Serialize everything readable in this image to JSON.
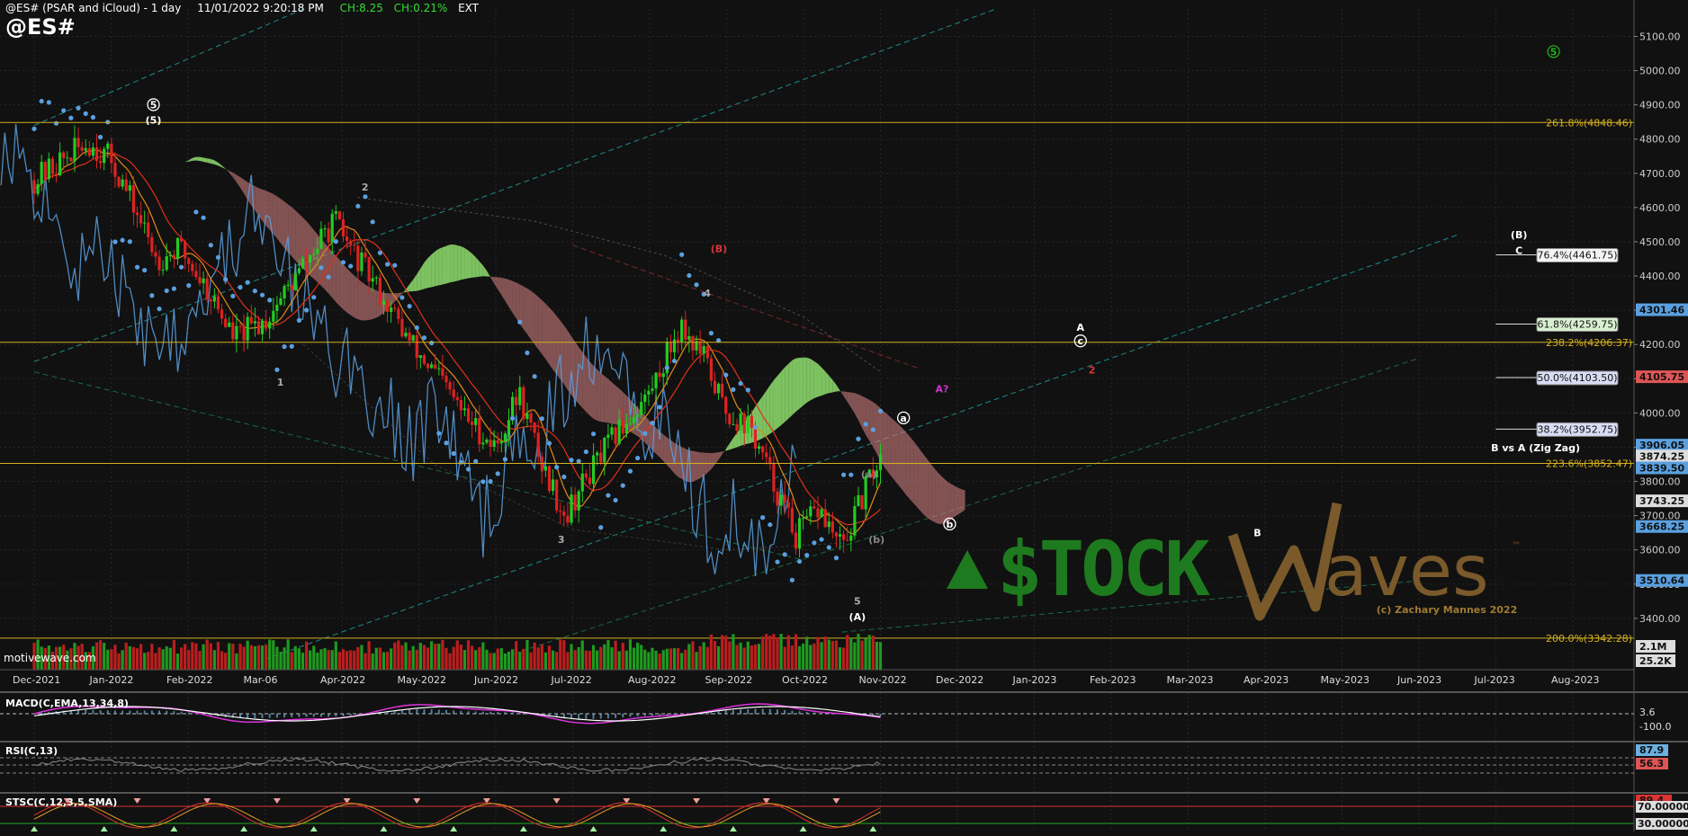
{
  "header": {
    "study": "@ES# (PSAR and iCloud) - 1 day",
    "datetime": "11/01/2022 9:20:18 PM",
    "change": "CH:8.25",
    "change_pct": "CH:0.21%",
    "session": "EXT"
  },
  "symbol": "@ES#",
  "watermark": "motivewave.com",
  "branding": {
    "logo_left": "$TOCK",
    "logo_right": "aves",
    "tm": "™",
    "copyright": "(c) Zachary Mannes 2022"
  },
  "colors": {
    "background": "#111111",
    "up_candle": "#22cc22",
    "down_candle": "#dd2222",
    "psar": "#5aa0e0",
    "fib": "#d4b020",
    "cloud_bull": "#90e070",
    "cloud_bear": "#d08080",
    "macd": "#dd33dd",
    "histogram": "#6ab0e0",
    "logo_green": "#1e7a1e",
    "logo_brown": "#7a5a2a"
  },
  "chart_data": [
    {
      "type": "line",
      "name": "price",
      "ylim": [
        3250,
        5180
      ],
      "x_labels": [
        "Dec-2021",
        "Jan-2022",
        "Feb-2022",
        "Mar-06",
        "Apr-2022",
        "May-2022",
        "Jun-2022",
        "Jul-2022",
        "Aug-2022",
        "Sep-2022",
        "Oct-2022",
        "Nov-2022",
        "Dec-2022",
        "Jan-2023",
        "Feb-2023",
        "Mar-2023",
        "Apr-2023",
        "May-2023",
        "Jun-2023",
        "Jul-2023",
        "Aug-2023"
      ],
      "y_ticks": [
        3400,
        3500,
        3600,
        3700,
        3800,
        3900,
        4000,
        4100,
        4200,
        4300,
        4400,
        4500,
        4600,
        4700,
        4800,
        4900,
        5000,
        5100
      ],
      "close_path": [
        [
          0,
          4680
        ],
        [
          0.25,
          4720
        ],
        [
          0.5,
          4760
        ],
        [
          0.7,
          4790
        ],
        [
          1.0,
          4740
        ],
        [
          1.3,
          4600
        ],
        [
          1.6,
          4450
        ],
        [
          1.9,
          4480
        ],
        [
          2.2,
          4380
        ],
        [
          2.6,
          4220
        ],
        [
          3.0,
          4270
        ],
        [
          3.5,
          4430
        ],
        [
          3.9,
          4560
        ],
        [
          4.2,
          4450
        ],
        [
          4.5,
          4350
        ],
        [
          4.9,
          4200
        ],
        [
          5.3,
          4090
        ],
        [
          5.6,
          3990
        ],
        [
          6.0,
          3900
        ],
        [
          6.3,
          4060
        ],
        [
          6.6,
          3850
        ],
        [
          6.9,
          3700
        ],
        [
          7.2,
          3820
        ],
        [
          7.6,
          3950
        ],
        [
          8.0,
          4060
        ],
        [
          8.4,
          4260
        ],
        [
          8.7,
          4160
        ],
        [
          9.0,
          4000
        ],
        [
          9.3,
          3960
        ],
        [
          9.6,
          3800
        ],
        [
          9.9,
          3640
        ],
        [
          10.2,
          3720
        ],
        [
          10.5,
          3600
        ],
        [
          10.9,
          3830
        ],
        [
          11.0,
          3870
        ]
      ],
      "current_price": 3874.25,
      "right_axis_labels": [
        {
          "value": "4301.46",
          "price": 4301.46,
          "color": "#5aa0e0"
        },
        {
          "value": "4105.75",
          "price": 4105.75,
          "color": "#dd5555"
        },
        {
          "value": "3906.05",
          "price": 3906.05,
          "color": "#5aa0e0"
        },
        {
          "value": "3874.25",
          "price": 3874.25,
          "color": "#dddddd"
        },
        {
          "value": "3839.50",
          "price": 3839.5,
          "color": "#5aa0e0"
        },
        {
          "value": "3743.25",
          "price": 3743.25,
          "color": "#dddddd"
        },
        {
          "value": "3668.25",
          "price": 3668.25,
          "color": "#5aa0e0"
        },
        {
          "value": "3510.64",
          "price": 3510.64,
          "color": "#5aa0e0"
        }
      ],
      "fib_levels": [
        {
          "label": "261.8%(4848.46)",
          "price": 4848.46,
          "boxed": false,
          "x0": 0
        },
        {
          "label": "238.2%(4206.37)",
          "price": 4206.37,
          "boxed": false,
          "x0": 0
        },
        {
          "label": "223.6%(3852.47)",
          "price": 3852.47,
          "boxed": false,
          "x0": 0
        },
        {
          "label": "200.0%(3342.28)",
          "price": 3342.28,
          "boxed": false,
          "x0": 0
        },
        {
          "label": "76.4%(4461.75)",
          "price": 4461.75,
          "boxed": true,
          "x0": 19.0
        },
        {
          "label": "61.8%(4259.75)",
          "price": 4259.75,
          "boxed": true,
          "x0": 19.0
        },
        {
          "label": "50.0%(4103.50)",
          "price": 4103.5,
          "boxed": true,
          "x0": 19.0
        },
        {
          "label": "38.2%(3952.75)",
          "price": 3952.75,
          "boxed": true,
          "x0": 19.0
        }
      ],
      "wave_labels": [
        {
          "text": "5",
          "x": 1.55,
          "price": 4890,
          "circle": true,
          "color": "#ffffff"
        },
        {
          "text": "(5)",
          "x": 1.55,
          "price": 4845,
          "color": "#ffffff"
        },
        {
          "text": "1",
          "x": 3.2,
          "price": 4080,
          "color": "#aaaaaa"
        },
        {
          "text": "2",
          "x": 4.3,
          "price": 4650,
          "color": "#aaaaaa"
        },
        {
          "text": "3",
          "x": 6.85,
          "price": 3620,
          "color": "#aaaaaa"
        },
        {
          "text": "(B)",
          "x": 8.9,
          "price": 4470,
          "color": "#dd3333"
        },
        {
          "text": "4",
          "x": 8.75,
          "price": 4340,
          "color": "#aaaaaa"
        },
        {
          "text": "5",
          "x": 10.7,
          "price": 3440,
          "color": "#aaaaaa"
        },
        {
          "text": "(A)",
          "x": 10.7,
          "price": 3395,
          "color": "#ffffff"
        },
        {
          "text": "(a)",
          "x": 10.85,
          "price": 3810,
          "color": "#888888"
        },
        {
          "text": "(b)",
          "x": 10.95,
          "price": 3620,
          "color": "#888888"
        },
        {
          "text": "a",
          "x": 11.3,
          "price": 3975,
          "circle": true,
          "color": "#ffffff"
        },
        {
          "text": "b",
          "x": 11.9,
          "price": 3665,
          "circle": true,
          "color": "#ffffff"
        },
        {
          "text": "A?",
          "x": 11.8,
          "price": 4060,
          "color": "#cc33cc"
        },
        {
          "text": "A",
          "x": 13.6,
          "price": 4240,
          "color": "#ffffff"
        },
        {
          "text": "c",
          "x": 13.6,
          "price": 4200,
          "circle": true,
          "color": "#ffffff"
        },
        {
          "text": "2",
          "x": 13.75,
          "price": 4115,
          "color": "#dd3333"
        },
        {
          "text": "B",
          "x": 15.9,
          "price": 3640,
          "color": "#ffffff"
        },
        {
          "text": "(B)",
          "x": 19.3,
          "price": 4510,
          "color": "#ffffff"
        },
        {
          "text": "C",
          "x": 19.3,
          "price": 4465,
          "color": "#ffffff"
        },
        {
          "text": "5",
          "x": 19.75,
          "price": 5045,
          "circle": true,
          "color": "#22aa22"
        }
      ],
      "annotation": "B vs A (Zig Zag)"
    },
    {
      "type": "bar",
      "name": "volume",
      "right_axis_labels": [
        "2.1M",
        "25.2K"
      ]
    },
    {
      "type": "line",
      "name": "MACD(C,EMA,13,34,8)",
      "title": "MACD(C,EMA,13,34,8)",
      "right_axis_labels": [
        "3.6",
        "-100.0"
      ]
    },
    {
      "type": "line",
      "name": "RSI(C,13)",
      "title": "RSI(C,13)",
      "right_axis_labels": [
        "87.9",
        "56.3"
      ]
    },
    {
      "type": "line",
      "name": "STSC(C,12,3,5,SMA)",
      "title": "STSC(C,12,3,5,SMA)",
      "right_axis_labels": [
        "89.4",
        "70.00000",
        "30.00000"
      ]
    }
  ]
}
